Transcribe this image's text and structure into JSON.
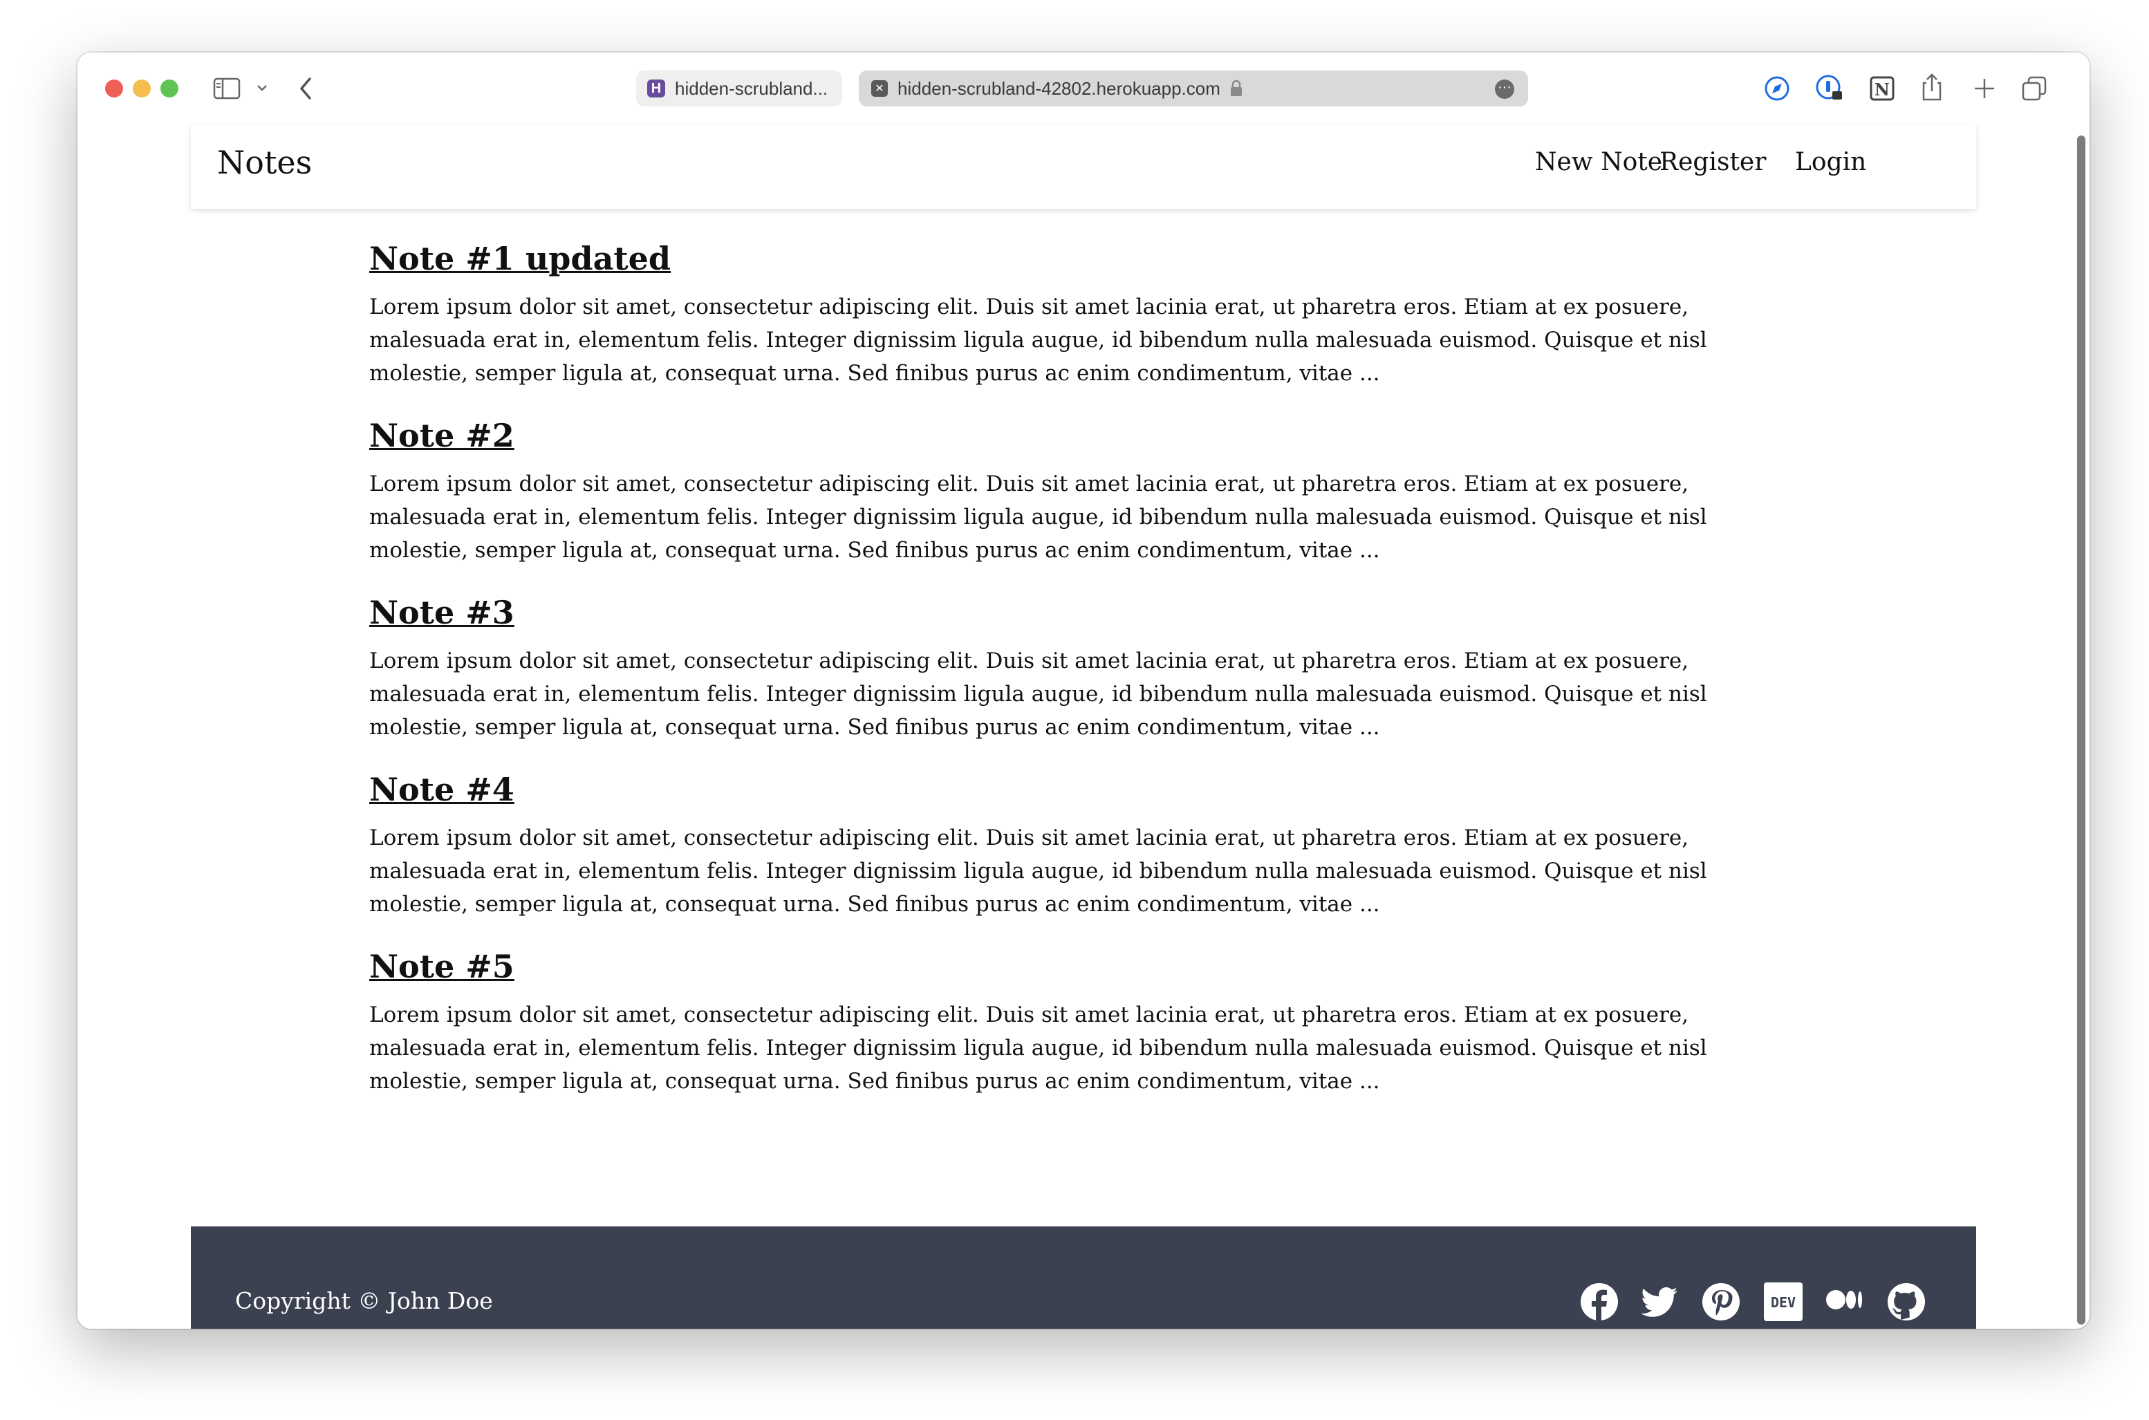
{
  "browser": {
    "tabs": [
      {
        "title": "hidden-scrubland..."
      },
      {
        "title": "hidden-scrubland-42802.herokuapp.com"
      }
    ]
  },
  "navbar": {
    "brand": "Notes",
    "links": [
      "New Note",
      "Register",
      "Login"
    ]
  },
  "notes": [
    {
      "title": "Note #1 updated",
      "body": "Lorem ipsum dolor sit amet, consectetur adipiscing elit. Duis sit amet lacinia erat, ut pharetra eros. Etiam at ex posuere, malesuada erat in, elementum felis. Integer dignissim ligula augue, id bibendum nulla malesuada euismod. Quisque et nisl molestie, semper ligula at, consequat urna. Sed finibus purus ac enim condimentum, vitae ..."
    },
    {
      "title": "Note #2",
      "body": "Lorem ipsum dolor sit amet, consectetur adipiscing elit. Duis sit amet lacinia erat, ut pharetra eros. Etiam at ex posuere, malesuada erat in, elementum felis. Integer dignissim ligula augue, id bibendum nulla malesuada euismod. Quisque et nisl molestie, semper ligula at, consequat urna. Sed finibus purus ac enim condimentum, vitae ..."
    },
    {
      "title": "Note #3",
      "body": "Lorem ipsum dolor sit amet, consectetur adipiscing elit. Duis sit amet lacinia erat, ut pharetra eros. Etiam at ex posuere, malesuada erat in, elementum felis. Integer dignissim ligula augue, id bibendum nulla malesuada euismod. Quisque et nisl molestie, semper ligula at, consequat urna. Sed finibus purus ac enim condimentum, vitae ..."
    },
    {
      "title": "Note #4",
      "body": "Lorem ipsum dolor sit amet, consectetur adipiscing elit. Duis sit amet lacinia erat, ut pharetra eros. Etiam at ex posuere, malesuada erat in, elementum felis. Integer dignissim ligula augue, id bibendum nulla malesuada euismod. Quisque et nisl molestie, semper ligula at, consequat urna. Sed finibus purus ac enim condimentum, vitae ..."
    },
    {
      "title": "Note #5",
      "body": "Lorem ipsum dolor sit amet, consectetur adipiscing elit. Duis sit amet lacinia erat, ut pharetra eros. Etiam at ex posuere, malesuada erat in, elementum felis. Integer dignissim ligula augue, id bibendum nulla malesuada euismod. Quisque et nisl molestie, semper ligula at, consequat urna. Sed finibus purus ac enim condimentum, vitae ..."
    }
  ],
  "footer": {
    "copyright": "Copyright © John Doe",
    "social_icons": [
      "facebook-icon",
      "twitter-icon",
      "pinterest-icon",
      "dev-icon",
      "medium-icon",
      "github-icon"
    ]
  },
  "colors": {
    "footer_bg": "#3b4150",
    "text": "#111111",
    "tab_active_bg": "#d9d9d9"
  }
}
